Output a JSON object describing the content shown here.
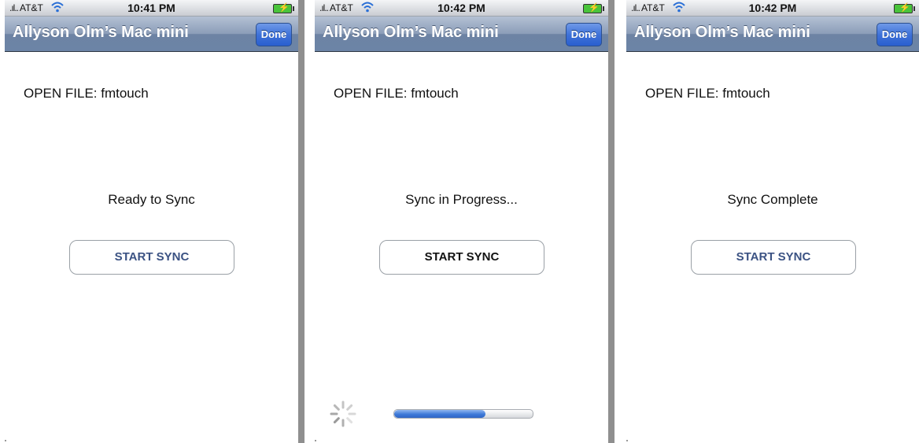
{
  "screens": [
    {
      "status_bar": {
        "carrier": "AT&T",
        "time": "10:41 PM"
      },
      "nav": {
        "title": "Allyson Olm’s Mac mini",
        "done_label": "Done"
      },
      "open_file": "OPEN FILE: fmtouch",
      "status": "Ready to Sync",
      "sync_button": "START SYNC"
    },
    {
      "status_bar": {
        "carrier": "AT&T",
        "time": "10:42 PM"
      },
      "nav": {
        "title": "Allyson Olm’s Mac mini",
        "done_label": "Done"
      },
      "open_file": "OPEN FILE: fmtouch",
      "status": "Sync in Progress...",
      "sync_button": "START SYNC",
      "progress_fraction": 0.66
    },
    {
      "status_bar": {
        "carrier": "AT&T",
        "time": "10:42 PM"
      },
      "nav": {
        "title": "Allyson Olm’s Mac mini",
        "done_label": "Done"
      },
      "open_file": "OPEN FILE: fmtouch",
      "status": "Sync Complete",
      "sync_button": "START SYNC"
    }
  ],
  "colors": {
    "nav_bar": "#7a8fb0",
    "done_button": "#3f72d8",
    "button_text_idle": "#3b5283",
    "button_text_active": "#111111",
    "progress_fill": "#3d79d8",
    "divider": "#8f8f8f"
  },
  "icons": [
    "signal-bars-icon",
    "wifi-icon",
    "battery-charging-icon",
    "activity-spinner-icon"
  ]
}
